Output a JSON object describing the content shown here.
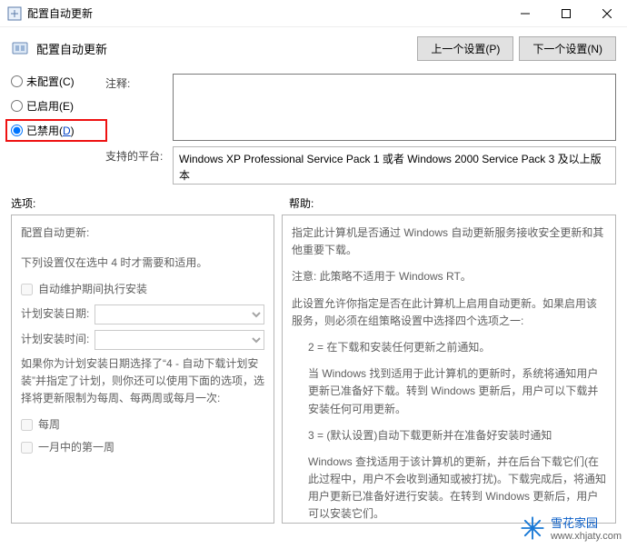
{
  "window": {
    "title": "配置自动更新",
    "sub_title": "配置自动更新",
    "prev_btn": "上一个设置(P)",
    "next_btn": "下一个设置(N)"
  },
  "radios": {
    "not_configured": "未配置(C)",
    "enabled": "已启用(E)",
    "disabled_prefix": "已禁用(",
    "disabled_key": "D",
    "disabled_suffix": ")"
  },
  "labels": {
    "comment": "注释:",
    "platform": "支持的平台:",
    "options": "选项:",
    "help": "帮助:"
  },
  "platform_text": "Windows XP Professional Service Pack 1 或者 Windows 2000 Service Pack 3 及以上版本",
  "options_pane": {
    "title": "配置自动更新:",
    "note": "下列设置仅在选中 4 时才需要和适用。",
    "chk_maint": "自动维护期间执行安装",
    "sched_day": "计划安装日期:",
    "sched_time": "计划安装时间:",
    "para": "如果你为计划安装日期选择了“4 - 自动下载计划安装”并指定了计划，则你还可以使用下面的选项，选择将更新限制为每周、每两周或每月一次:",
    "chk_week": "每周",
    "chk_first": "一月中的第一周"
  },
  "help_pane": {
    "p1": "指定此计算机是否通过 Windows 自动更新服务接收安全更新和其他重要下载。",
    "p2": "注意: 此策略不适用于 Windows RT。",
    "p3": "此设置允许你指定是否在此计算机上启用自动更新。如果启用该服务，则必须在组策略设置中选择四个选项之一:",
    "p4": "2 = 在下载和安装任何更新之前通知。",
    "p5": "当 Windows 找到适用于此计算机的更新时，系统将通知用户更新已准备好下载。转到 Windows 更新后，用户可以下载并安装任何可用更新。",
    "p6": "3 = (默认设置)自动下载更新并在准备好安装时通知",
    "p7": "Windows 查找适用于该计算机的更新，并在后台下载它们(在此过程中，用户不会收到通知或被打扰)。下载完成后，将通知用户更新已准备好进行安装。在转到 Windows 更新后，用户可以安装它们。"
  },
  "watermark": {
    "name": "雪花家园",
    "url": "www.xhjaty.com"
  }
}
